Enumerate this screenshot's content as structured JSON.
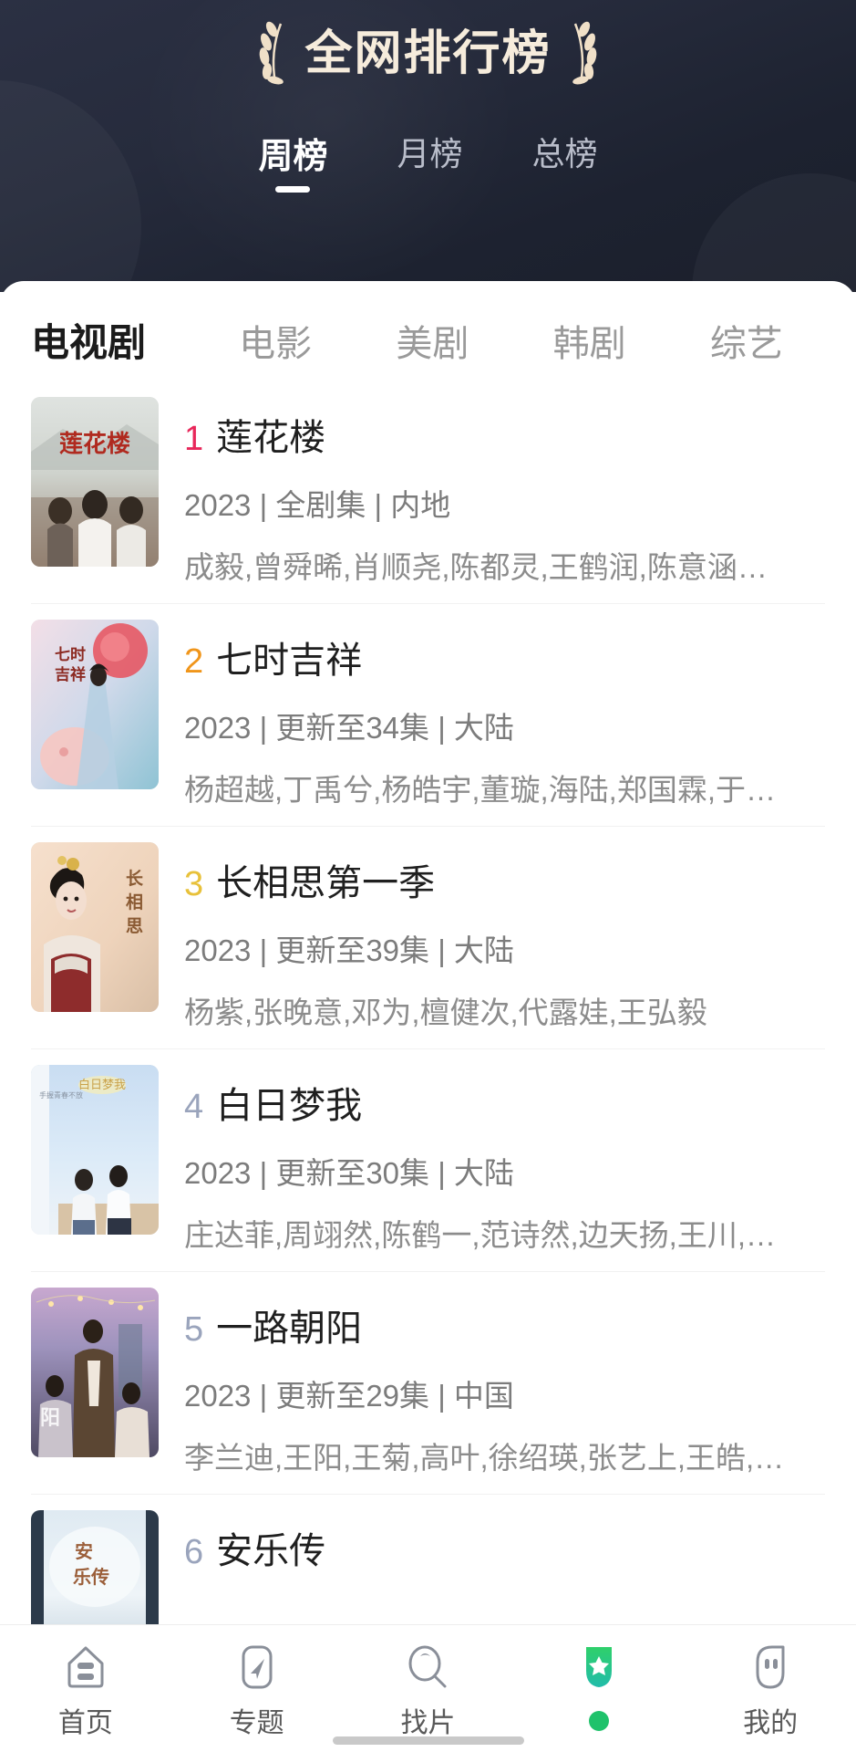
{
  "header": {
    "title": "全网排行榜",
    "laurel_left_icon": "laurel-left-icon",
    "laurel_right_icon": "laurel-right-icon",
    "period_tabs": [
      {
        "label": "周榜",
        "active": true
      },
      {
        "label": "月榜",
        "active": false
      },
      {
        "label": "总榜",
        "active": false
      }
    ]
  },
  "category_tabs": [
    {
      "label": "电视剧",
      "active": true
    },
    {
      "label": "电影",
      "active": false
    },
    {
      "label": "美剧",
      "active": false
    },
    {
      "label": "韩剧",
      "active": false
    },
    {
      "label": "综艺",
      "active": false
    }
  ],
  "colors": {
    "rank1": "#e8275a",
    "rank2": "#f0951a",
    "rank3": "#e8c13a",
    "rank_default": "#9aa4bc",
    "header_bg": "#262b3c",
    "accent_green": "#1fc26b",
    "active_text": "#1b1b1b",
    "muted_text": "#9a9a9a"
  },
  "list": [
    {
      "rank": "1",
      "rank_color": "#e8275a",
      "name": "莲花楼",
      "info": "2023 | 全剧集 | 内地",
      "cast": "成毅,曾舜晞,肖顺尧,陈都灵,王鹤润,陈意涵…",
      "poster_name": "poster-lianhualou"
    },
    {
      "rank": "2",
      "rank_color": "#f0951a",
      "name": "七时吉祥",
      "info": "2023 | 更新至34集 | 大陆",
      "cast": "杨超越,丁禹兮,杨皓宇,董璇,海陆,郑国霖,于…",
      "poster_name": "poster-qishijixiang"
    },
    {
      "rank": "3",
      "rank_color": "#e8c13a",
      "name": "长相思第一季",
      "info": "2023 | 更新至39集 | 大陆",
      "cast": "杨紫,张晚意,邓为,檀健次,代露娃,王弘毅",
      "poster_name": "poster-changxiangsi"
    },
    {
      "rank": "4",
      "rank_color": "#9aa4bc",
      "name": "白日梦我",
      "info": "2023 | 更新至30集 | 大陆",
      "cast": "庄达菲,周翊然,陈鹤一,范诗然,边天扬,王川,…",
      "poster_name": "poster-bairimengwo"
    },
    {
      "rank": "5",
      "rank_color": "#9aa4bc",
      "name": "一路朝阳",
      "info": "2023 | 更新至29集 | 中国",
      "cast": "李兰迪,王阳,王菊,高叶,徐绍瑛,张艺上,王皓,…",
      "poster_name": "poster-yiluzhaoyang"
    },
    {
      "rank": "6",
      "rank_color": "#9aa4bc",
      "name": "安乐传",
      "info": "",
      "cast": "",
      "poster_name": "poster-anlezhuan"
    }
  ],
  "bottom_nav": [
    {
      "label": "首页",
      "icon": "home-icon",
      "active": false
    },
    {
      "label": "专题",
      "icon": "navigate-icon",
      "active": false
    },
    {
      "label": "找片",
      "icon": "search-icon",
      "active": false
    },
    {
      "label": "",
      "icon": "star-shield-icon",
      "active": true
    },
    {
      "label": "我的",
      "icon": "profile-icon",
      "active": false
    }
  ]
}
